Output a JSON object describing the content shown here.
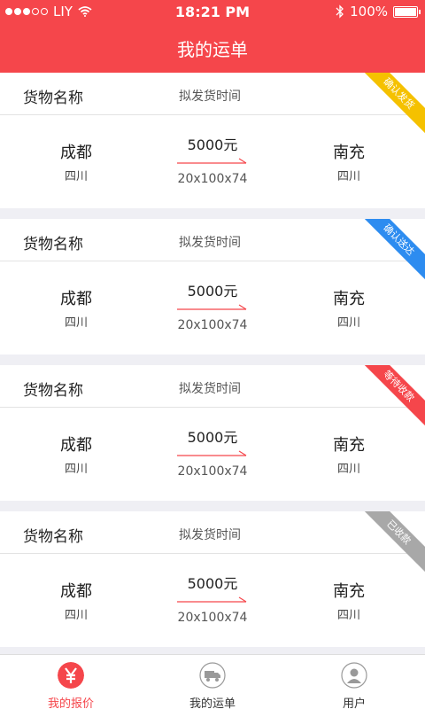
{
  "status": {
    "carrier": "LIY",
    "time": "18:21 PM",
    "battery": "100%"
  },
  "header": {
    "title": "我的运单"
  },
  "orders": [
    {
      "goods": "货物名称",
      "ship_time": "拟发货时间",
      "from_city": "成都",
      "from_province": "四川",
      "to_city": "南充",
      "to_province": "四川",
      "price": "5000元",
      "dims": "20x100x74",
      "status": "确认发货",
      "status_color": "#f5c100"
    },
    {
      "goods": "货物名称",
      "ship_time": "拟发货时间",
      "from_city": "成都",
      "from_province": "四川",
      "to_city": "南充",
      "to_province": "四川",
      "price": "5000元",
      "dims": "20x100x74",
      "status": "确认送达",
      "status_color": "#2d8cf0"
    },
    {
      "goods": "货物名称",
      "ship_time": "拟发货时间",
      "from_city": "成都",
      "from_province": "四川",
      "to_city": "南充",
      "to_province": "四川",
      "price": "5000元",
      "dims": "20x100x74",
      "status": "等待收款",
      "status_color": "#f5464b"
    },
    {
      "goods": "货物名称",
      "ship_time": "拟发货时间",
      "from_city": "成都",
      "from_province": "四川",
      "to_city": "南充",
      "to_province": "四川",
      "price": "5000元",
      "dims": "20x100x74",
      "status": "已收款",
      "status_color": "#a8a8a8"
    }
  ],
  "tabs": [
    {
      "label": "我的报价",
      "icon": "yen-icon",
      "active": true
    },
    {
      "label": "我的运单",
      "icon": "truck-icon",
      "active": false
    },
    {
      "label": "用户",
      "icon": "user-icon",
      "active": false
    }
  ],
  "colors": {
    "brand": "#f5464b"
  }
}
